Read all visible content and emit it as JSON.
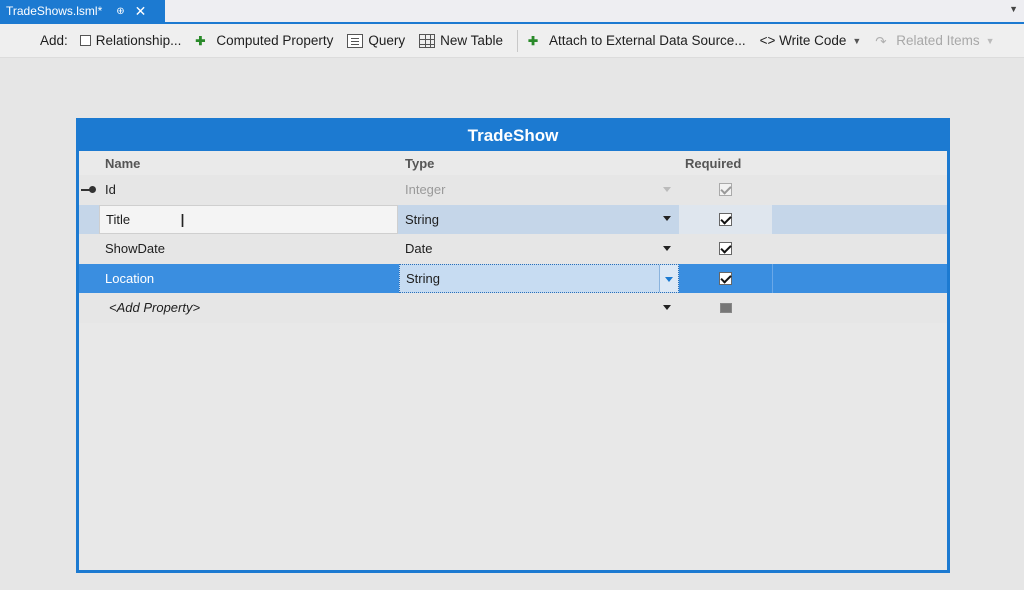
{
  "tab": {
    "title": "TradeShows.lsml*",
    "pin_glyph": "⊕",
    "close_glyph": "✕"
  },
  "toolbar": {
    "add_label": "Add:",
    "relationship": "Relationship...",
    "computed_property": "Computed Property",
    "query": "Query",
    "new_table": "New Table",
    "attach": "Attach to External Data Source...",
    "write_code": "<> Write Code",
    "related_items": "Related Items"
  },
  "entity": {
    "title": "TradeShow",
    "columns": {
      "name": "Name",
      "type": "Type",
      "required": "Required"
    },
    "rows": [
      {
        "name": "Id",
        "type": "Integer",
        "required": true,
        "key": true
      },
      {
        "name": "Title",
        "type": "String",
        "required": true
      },
      {
        "name": "ShowDate",
        "type": "Date",
        "required": true
      },
      {
        "name": "Location",
        "type": "String",
        "required": true,
        "selected": true
      }
    ],
    "add_property": "<Add Property>"
  },
  "colors": {
    "accent": "#1c7ad1",
    "selection": "#3a8ee0"
  }
}
